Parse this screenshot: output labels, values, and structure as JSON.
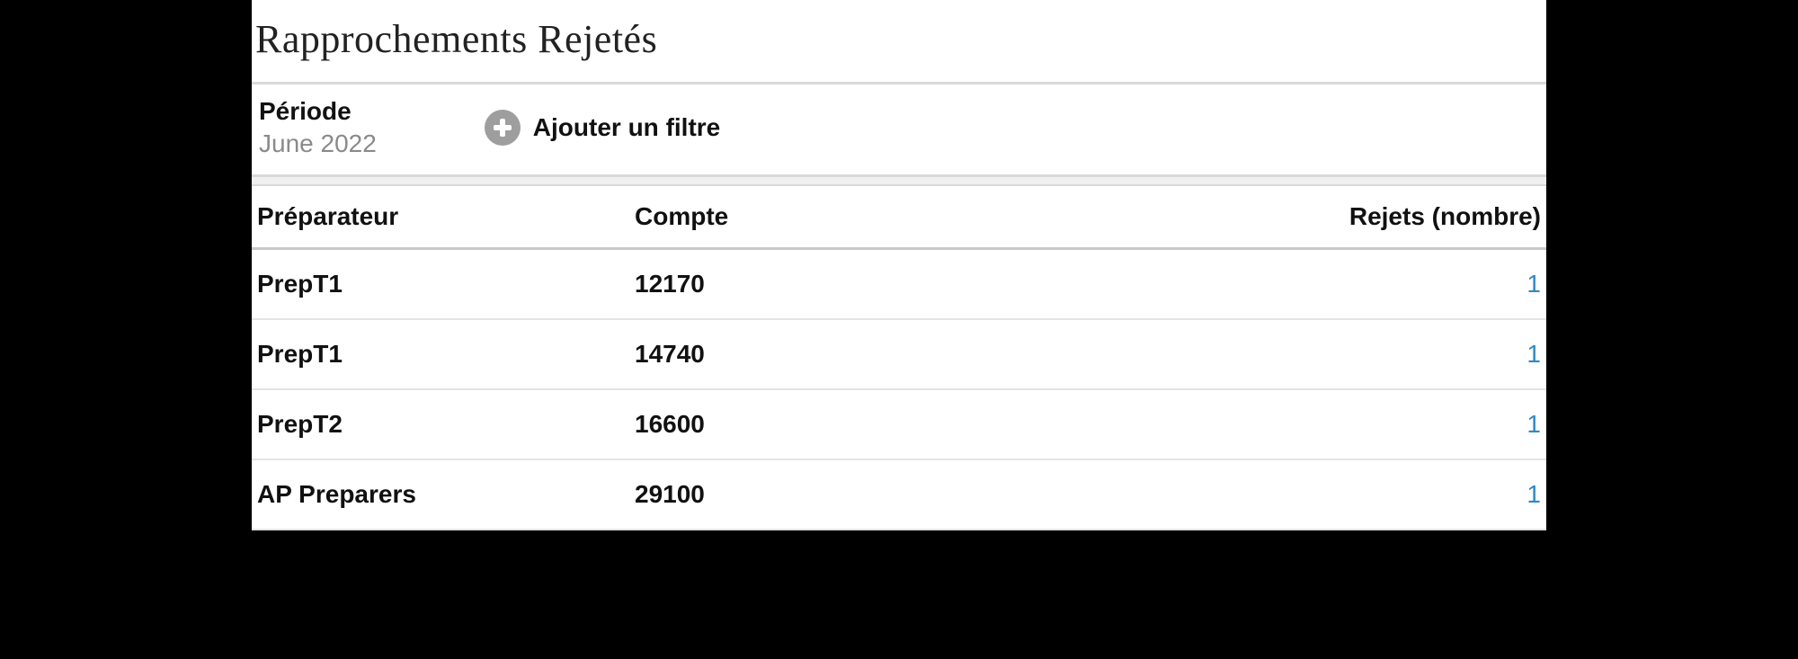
{
  "title": "Rapprochements Rejetés",
  "filter": {
    "period_label": "Période",
    "period_value": "June 2022",
    "add_filter_label": "Ajouter un filtre"
  },
  "table": {
    "columns": {
      "preparer": "Préparateur",
      "compte": "Compte",
      "rejets": "Rejets (nombre)"
    },
    "rows": [
      {
        "preparer": "PrepT1",
        "compte": "12170",
        "rejets": "1"
      },
      {
        "preparer": "PrepT1",
        "compte": "14740",
        "rejets": "1"
      },
      {
        "preparer": "PrepT2",
        "compte": "16600",
        "rejets": "1"
      },
      {
        "preparer": "AP Preparers",
        "compte": "29100",
        "rejets": "1"
      }
    ]
  }
}
